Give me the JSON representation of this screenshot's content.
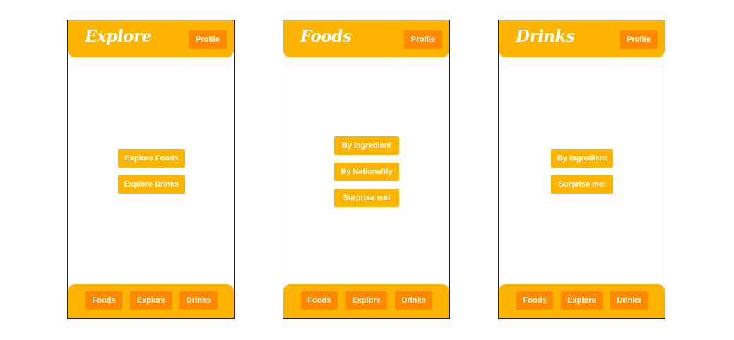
{
  "colors": {
    "primary": "#fdb400",
    "accent": "#ff8a00",
    "text": "#ffffff"
  },
  "screens": [
    {
      "title": "Explore",
      "profile_label": "Profile",
      "buttons": [
        "Explore Foods",
        "Explore Drinks"
      ],
      "footer": [
        "Foods",
        "Explore",
        "Drinks"
      ]
    },
    {
      "title": "Foods",
      "profile_label": "Profile",
      "buttons": [
        "By Ingredient",
        "By Nationality",
        "Surprise me!"
      ],
      "footer": [
        "Foods",
        "Explore",
        "Drinks"
      ]
    },
    {
      "title": "Drinks",
      "profile_label": "Profile",
      "buttons": [
        "By Ingredient",
        "Surprise me!"
      ],
      "footer": [
        "Foods",
        "Explore",
        "Drinks"
      ]
    }
  ]
}
